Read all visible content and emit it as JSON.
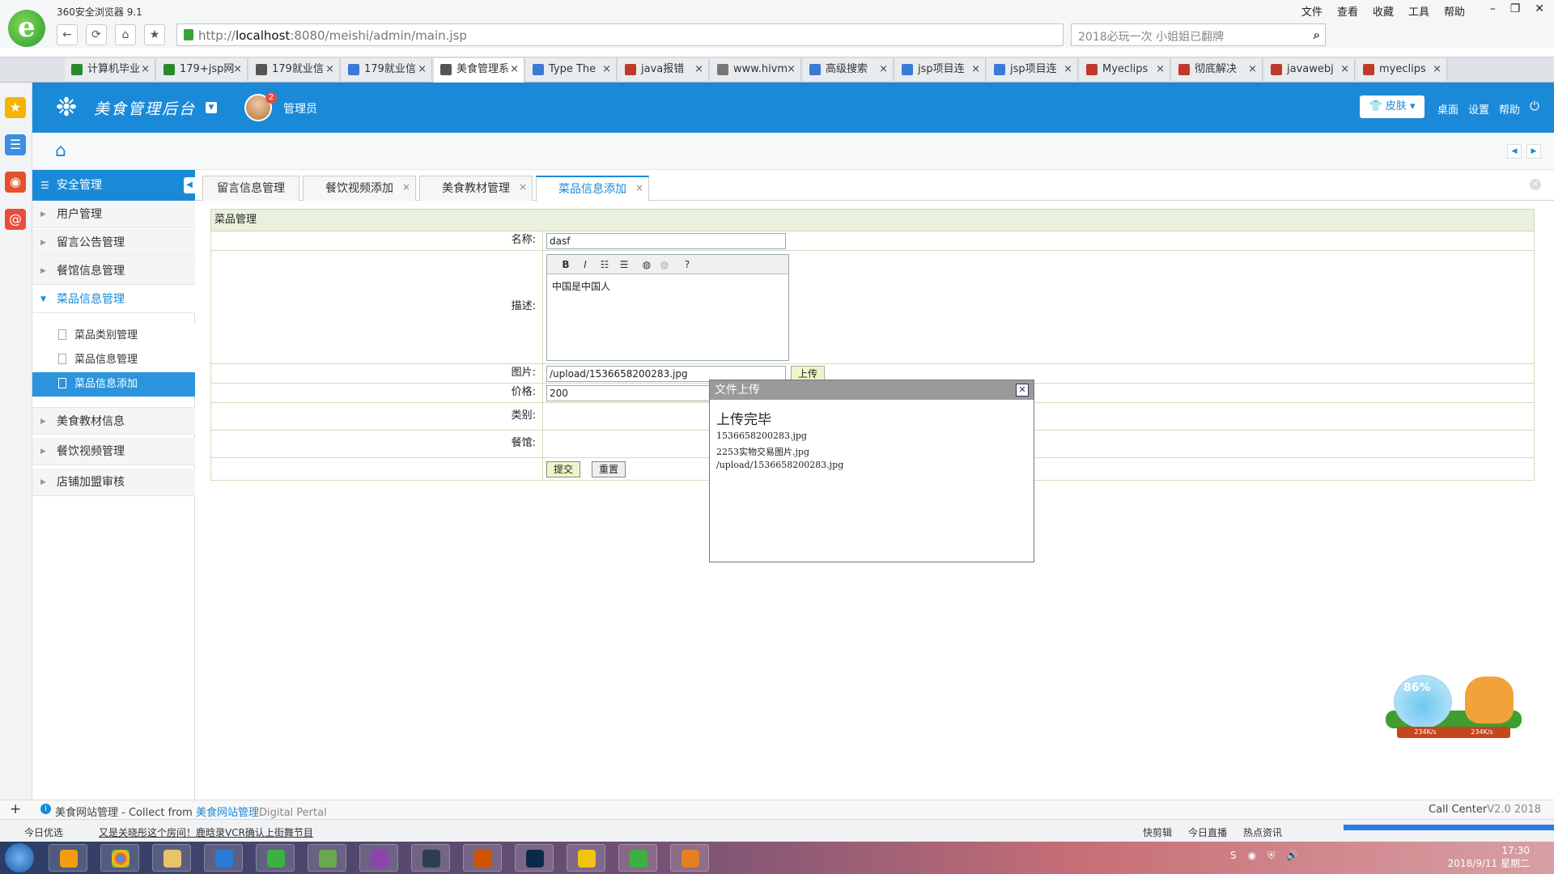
{
  "browser": {
    "title": "360安全浏览器 9.1",
    "menu": [
      "文件",
      "查看",
      "收藏",
      "工具",
      "帮助"
    ],
    "url_prefix": "http://",
    "url_host": "localhost",
    "url_rest": ":8080/meishi/admin/main.jsp",
    "search_text": "2018必玩一次 小姐姐已翻牌",
    "tabs": [
      {
        "label": "计算机毕业",
        "color": "#2a8a2a"
      },
      {
        "label": "179+jsp网",
        "color": "#2a8a2a"
      },
      {
        "label": "179就业信",
        "color": "#555"
      },
      {
        "label": "179就业信",
        "color": "#3a7bd5"
      },
      {
        "label": "美食管理系",
        "color": "#555",
        "active": true
      },
      {
        "label": "Type The",
        "color": "#3a7bd5"
      },
      {
        "label": "java报错",
        "color": "#c0392b"
      },
      {
        "label": "www.hivm",
        "color": "#777"
      },
      {
        "label": "高级搜索",
        "color": "#3a7bd5"
      },
      {
        "label": "jsp项目连",
        "color": "#3a7bd5"
      },
      {
        "label": "jsp项目连",
        "color": "#3a7bd5"
      },
      {
        "label": "Myeclips",
        "color": "#c0392b"
      },
      {
        "label": "彻底解决",
        "color": "#c0392b"
      },
      {
        "label": "javawebj",
        "color": "#c0392b"
      },
      {
        "label": "myeclips",
        "color": "#c0392b"
      }
    ]
  },
  "app": {
    "brand": "美食管理后台",
    "admin_name": "管理员",
    "badge": "2",
    "skin": "皮肤",
    "header_links": [
      "桌面",
      "设置",
      "帮助"
    ]
  },
  "sidebar": {
    "head": "安全管理",
    "items": [
      "用户管理",
      "留言公告管理",
      "餐馆信息管理",
      "菜品信息管理"
    ],
    "subitems": [
      "菜品类别管理",
      "菜品信息管理",
      "菜品信息添加"
    ],
    "items2": [
      "美食教材信息",
      "餐饮视频管理",
      "店铺加盟审核"
    ]
  },
  "content_tabs": [
    "留言信息管理",
    "餐饮视频添加",
    "美食教材管理",
    "菜品信息添加"
  ],
  "form": {
    "section": "菜品管理",
    "labels": {
      "name": "名称:",
      "desc": "描述:",
      "image": "图片:",
      "price": "价格:",
      "category": "类别:",
      "restaurant": "餐馆:"
    },
    "values": {
      "name": "dasf",
      "desc": "中国是中国人",
      "image": "/upload/1536658200283.jpg",
      "price": "200"
    },
    "upload_btn": "上传",
    "submit": "提交",
    "reset": "重置"
  },
  "popup": {
    "title": "文件上传",
    "heading": "上传完毕",
    "lines": [
      "1536658200283.jpg",
      "2253实物交易图片.jpg",
      "/upload/1536658200283.jpg"
    ]
  },
  "gadget": {
    "percent": "86%",
    "up": "234K/s",
    "down": "234K/s"
  },
  "footer": {
    "left_prefix": "美食网站管理 - Collect from ",
    "left_link": "美食网站管理",
    "left_suffix": "Digital Pertal",
    "right": "Call Center",
    "right_ver": "V2.0 2018"
  },
  "statusbar": {
    "today": "今日优选",
    "news": "又是关晓彤这个房间！鹿晗录VCR确认上街舞节目",
    "right": [
      "快剪辑",
      "今日直播",
      "热点资讯"
    ]
  },
  "clock": {
    "time": "17:30",
    "date": "2018/9/11 星期二"
  }
}
